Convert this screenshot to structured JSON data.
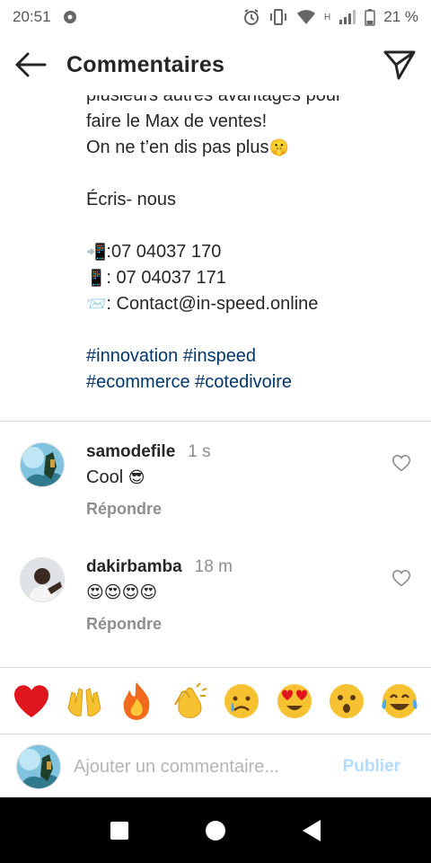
{
  "status_bar": {
    "time": "20:51",
    "network_label": "H",
    "battery": "21 %"
  },
  "header": {
    "title": "Commentaires",
    "back_icon": "arrow-left-icon",
    "share_icon": "send-icon"
  },
  "caption": {
    "lines": [
      "plusieurs autres avantages pour",
      "faire le Max de ventes!",
      "On ne t’en dis pas plus",
      "",
      "Écris- nous",
      "",
      ":07 04037 170",
      ": 07 04037 171",
      ": Contact@in-speed.online",
      ""
    ],
    "hashtags_line1": [
      "#innovation",
      "#inspeed"
    ],
    "hashtags_line2": [
      "#ecommerce",
      "#cotedivoire"
    ]
  },
  "comments": [
    {
      "username": "samodefile",
      "time": "1 s",
      "text": "Cool",
      "reply_label": "Répondre"
    },
    {
      "username": "dakirbamba",
      "time": "18 m",
      "text": "",
      "reply_label": "Répondre"
    }
  ],
  "emoji_bar": [
    "red-heart",
    "raising-hands",
    "fire",
    "clapping-hands",
    "crying-face",
    "heart-eyes",
    "surprised-face",
    "tears-of-joy"
  ],
  "composer": {
    "placeholder": "Ajouter un commentaire...",
    "publish_label": "Publier"
  },
  "colors": {
    "hashtag": "#00376b",
    "secondary_text": "#8e8e8e",
    "publish_disabled": "#b3dbff",
    "divider": "#dbdbdb"
  }
}
